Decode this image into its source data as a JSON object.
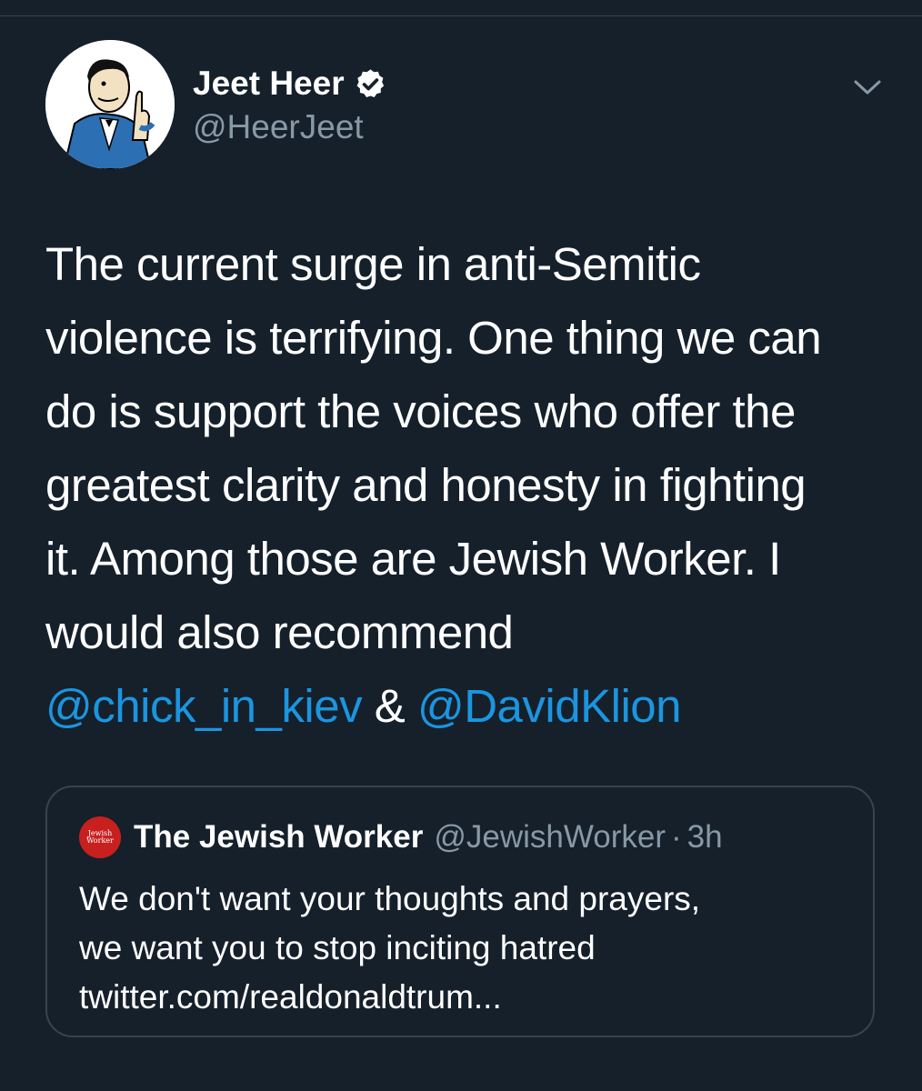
{
  "tweet": {
    "author": {
      "name": "Jeet Heer",
      "handle": "@HeerJeet",
      "verified": true
    },
    "text_lines": [
      "The current surge in anti-Semitic",
      "violence is terrifying. One thing we can",
      "do is support the voices who offer the",
      "greatest clarity and honesty in fighting",
      "it. Among those are Jewish Worker.  I",
      "would also recommend"
    ],
    "mention_1": "@chick_in_kiev",
    "mention_joiner": " & ",
    "mention_2": "@DavidKlion",
    "menu_icon": "chevron-down-icon"
  },
  "quote": {
    "avatar_text_1": "Jewish",
    "avatar_text_2": "Worker",
    "name": "The Jewish Worker",
    "handle": "@JewishWorker",
    "separator": "·",
    "time": "3h",
    "text_lines": [
      "We don't want your thoughts and prayers,",
      "we want you to stop inciting hatred",
      "twitter.com/realdonaldtrum..."
    ]
  },
  "colors": {
    "background": "#15202b",
    "primary_text": "#ffffff",
    "secondary_text": "#8899a6",
    "link": "#1b95e0",
    "border": "#38444d",
    "quote_avatar": "#c8201f"
  }
}
